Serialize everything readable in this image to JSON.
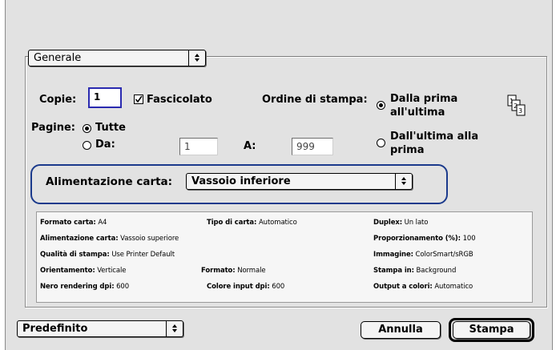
{
  "panel_menu": {
    "value": "Generale"
  },
  "copies": {
    "label": "Copie:",
    "value": "1",
    "collate_label": "Fascicolato",
    "collate_checked": true
  },
  "order": {
    "label": "Ordine di stampa:",
    "option_first_line1": "Dalla prima",
    "option_first_line2": "all'ultima",
    "option_last_line1": "Dall'ultima alla",
    "option_last_line2": "prima"
  },
  "pages": {
    "label": "Pagine:",
    "all_label": "Tutte",
    "from_label": "Da:",
    "from_value": "1",
    "to_label": "A:",
    "to_value": "999"
  },
  "paper_source": {
    "label": "Alimentazione carta:",
    "value": "Vassoio inferiore"
  },
  "summary": {
    "r1c1_key": "Formato carta:",
    "r1c1_val": "A4",
    "r1c2_key": "Tipo di carta:",
    "r1c2_val": "Automatico",
    "r1c3_key": "Duplex:",
    "r1c3_val": "Un lato",
    "r2c1_key": "Alimentazione carta:",
    "r2c1_val": "Vassoio superiore",
    "r2c3_key": "Proporzionamento (%):",
    "r2c3_val": "100",
    "r3c1_key": "Qualità di stampa:",
    "r3c1_val": "Use Printer Default",
    "r3c3_key": "Immagine:",
    "r3c3_val": "ColorSmart/sRGB",
    "r4c1_key": "Orientamento:",
    "r4c1_val": "Verticale",
    "r4c2_key": "Formato:",
    "r4c2_val": "Normale",
    "r4c3_key": "Stampa in:",
    "r4c3_val": "Background",
    "r5c1_key": "Nero rendering dpi:",
    "r5c1_val": "600",
    "r5c2_key": "Colore input dpi:",
    "r5c2_val": "600",
    "r5c3_key": "Output a colori:",
    "r5c3_val": "Automatico"
  },
  "footer": {
    "preset_value": "Predefinito",
    "cancel_label": "Annulla",
    "print_label": "Stampa"
  },
  "colors": {
    "highlight": "#1b3a8c",
    "field_focus": "#2a2ab0"
  },
  "icons": [
    "popup-arrows-icon",
    "collate-order-icon",
    "checkmark-icon"
  ]
}
